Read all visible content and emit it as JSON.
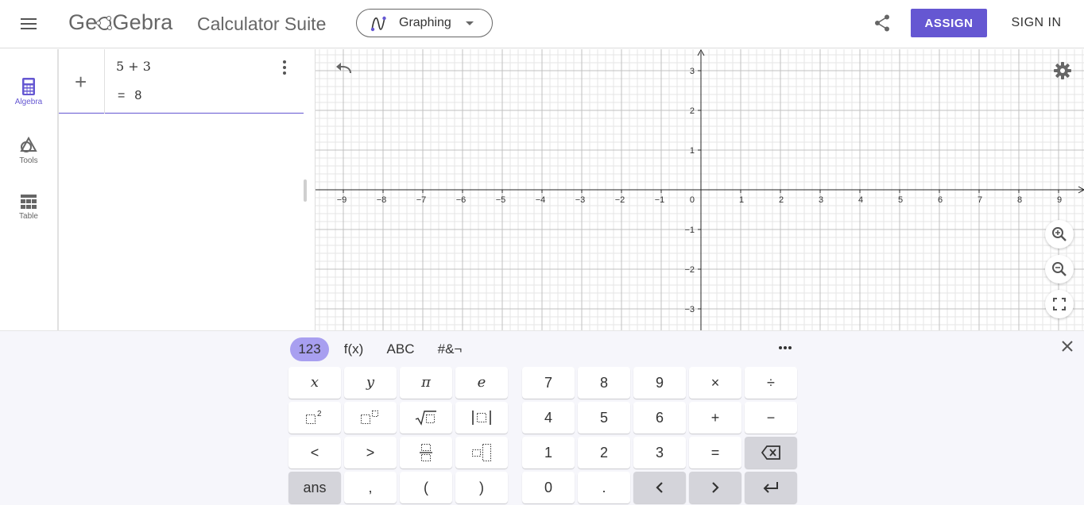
{
  "header": {
    "logo_text_left": "Ge",
    "logo_text_right": "Gebra",
    "suite_title": "Calculator Suite",
    "app_select_label": "Graphing",
    "assign_label": "ASSIGN",
    "signin_label": "SIGN IN"
  },
  "colors": {
    "accent": "#6557d2",
    "tab_active": "#a89ff0",
    "axis": "#252525",
    "grid_major": "#c0c0c0",
    "grid_minor": "#e6e6e6"
  },
  "rail": {
    "items": [
      {
        "label": "Algebra",
        "icon": "calculator-icon",
        "active": true
      },
      {
        "label": "Tools",
        "icon": "shapes-icon",
        "active": false
      },
      {
        "label": "Table",
        "icon": "table-icon",
        "active": false
      }
    ]
  },
  "algebra": {
    "input": "5 + 3",
    "output_eq": "=",
    "output_value": "8"
  },
  "graph": {
    "x_ticks": [
      "−9",
      "−8",
      "−7",
      "−6",
      "−5",
      "−4",
      "−3",
      "−2",
      "−1",
      "1",
      "2",
      "3",
      "4",
      "5",
      "6",
      "7",
      "8",
      "9"
    ],
    "y_ticks": [
      "3",
      "2",
      "1",
      "−1",
      "−2",
      "−3"
    ],
    "origin_label": "0"
  },
  "keyboard": {
    "tabs": [
      {
        "label": "123",
        "active": true
      },
      {
        "label": "f(x)",
        "active": false
      },
      {
        "label": "ABC",
        "active": false
      },
      {
        "label": "#&¬",
        "active": false
      }
    ],
    "left_keys": [
      [
        "x",
        "y",
        "π",
        "e"
      ],
      [
        "□²",
        "□ⁿ",
        "√□",
        "|□|"
      ],
      [
        "<",
        ">",
        "□⁄□",
        "□_□"
      ],
      [
        "ans",
        ",",
        "(",
        ")"
      ]
    ],
    "right_keys": [
      [
        "7",
        "8",
        "9",
        "×",
        "÷"
      ],
      [
        "4",
        "5",
        "6",
        "+",
        "−"
      ],
      [
        "1",
        "2",
        "3",
        "=",
        "⌫"
      ],
      [
        "0",
        ".",
        "‹",
        "›",
        "↵"
      ]
    ]
  }
}
